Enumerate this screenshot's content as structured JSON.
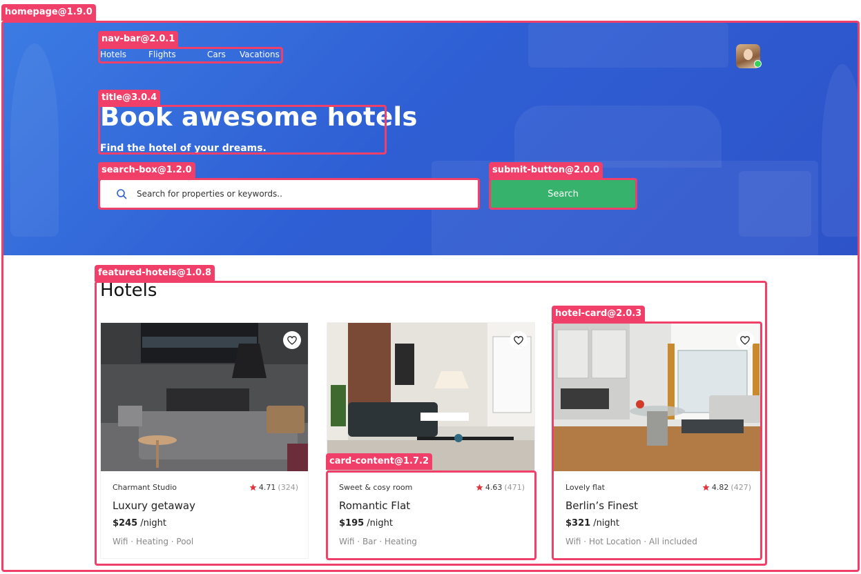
{
  "annotations": {
    "homepage": "homepage@1.9.0",
    "nav_bar": "nav-bar@2.0.1",
    "title": "title@3.0.4",
    "search_box": "search-box@1.2.0",
    "submit_button": "submit-button@2.0.0",
    "featured_hotels": "featured-hotels@1.0.8",
    "hotel_card": "hotel-card@2.0.3",
    "card_content": "card-content@1.7.2"
  },
  "nav": {
    "items": [
      {
        "label": "Hotels"
      },
      {
        "label": "Flights"
      },
      {
        "label": "Cars"
      },
      {
        "label": "Vacations"
      }
    ]
  },
  "hero": {
    "title": "Book awesome hotels",
    "subtitle": "Find the hotel of your dreams."
  },
  "search": {
    "placeholder": "Search for properties or keywords..",
    "button_label": "Search",
    "icon": "search-icon"
  },
  "featured": {
    "title": "Hotels",
    "cards": [
      {
        "type": "Charmant Studio",
        "rating": "4.71",
        "reviews": "(324)",
        "name": "Luxury getaway",
        "price": "$245",
        "per": "/night",
        "amenities": "Wifi · Heating · Pool"
      },
      {
        "type": "Sweet & cosy room",
        "rating": "4.63",
        "reviews": "(471)",
        "name": "Romantic Flat",
        "price": "$195",
        "per": "/night",
        "amenities": "Wifi · Bar · Heating"
      },
      {
        "type": "Lovely flat",
        "rating": "4.82",
        "reviews": "(427)",
        "name": "Berlin’s Finest",
        "price": "$321",
        "per": "/night",
        "amenities": "Wifi · Hot Location · All included"
      }
    ]
  },
  "colors": {
    "hero_blue": "#3067d8",
    "accent_pink": "#f0406a",
    "button_green": "#37b26c",
    "star_red": "#e0383e",
    "status_green": "#37d05b"
  }
}
